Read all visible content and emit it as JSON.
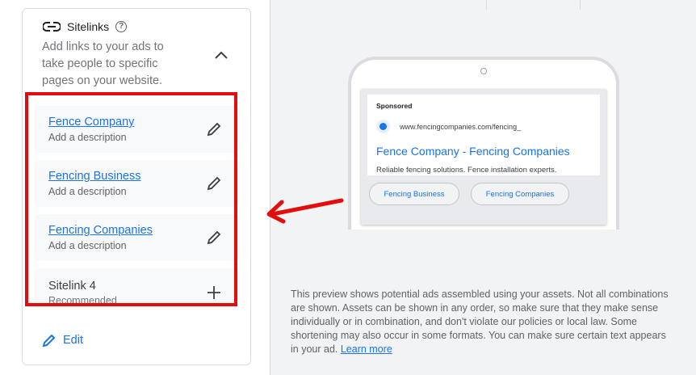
{
  "panel": {
    "title": "Sitelinks",
    "help": "?",
    "description": "Add links to your ads to take people to specific pages on your website."
  },
  "sitelinks": [
    {
      "title": "Fence Company",
      "sub": "Add a description"
    },
    {
      "title": "Fencing Business",
      "sub": "Add a description"
    },
    {
      "title": "Fencing Companies",
      "sub": "Add a description"
    }
  ],
  "sitelink4": {
    "title": "Sitelink 4",
    "sub": "Recommended"
  },
  "edit_label": "Edit",
  "ad_preview": {
    "sponsored": "Sponsored",
    "url": "www.fencingcompanies.com/fencing_",
    "headline": "Fence Company - Fencing Companies",
    "description": "Reliable fencing solutions. Fence installation experts.",
    "chips": [
      "Fencing Business",
      "Fencing Companies"
    ]
  },
  "preview_note": "This preview shows potential ads assembled using your assets. Not all combinations are shown. Assets can be shown in any order, so make sure that they make sense individually or in combination, and don't violate our policies or local law. Some shortening may also occur in some formats. You can make sure certain text appears in your ad.",
  "learn_more": "Learn more",
  "colors": {
    "accent": "#1a73e8",
    "highlight": "#e30d0d"
  }
}
